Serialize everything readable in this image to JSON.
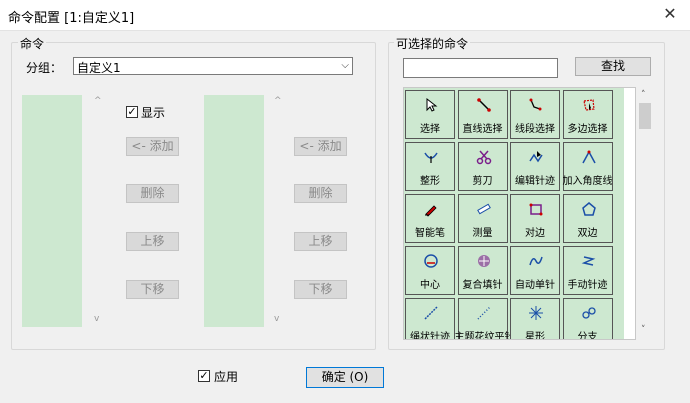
{
  "window": {
    "title": "命令配置 [1:自定义1]",
    "close": "✕"
  },
  "left_group": {
    "legend": "命令",
    "group_label": "分组：",
    "group_value": "自定义1",
    "show_label": "显示",
    "show_checked": "✓",
    "buttons": {
      "add": "<- 添加",
      "delete": "删除",
      "up": "上移",
      "down": "下移"
    }
  },
  "right_group": {
    "legend": "可选择的命令",
    "search_placeholder": "",
    "find_button": "查找",
    "commands": [
      {
        "label": "选择",
        "icon": "cursor-icon"
      },
      {
        "label": "直线选择",
        "icon": "line-select-icon"
      },
      {
        "label": "线段选择",
        "icon": "segment-select-icon"
      },
      {
        "label": "多边选择",
        "icon": "polygon-select-icon"
      },
      {
        "label": "整形",
        "icon": "reshape-icon"
      },
      {
        "label": "剪刀",
        "icon": "scissors-icon"
      },
      {
        "label": "编辑针迹",
        "icon": "edit-stitch-icon"
      },
      {
        "label": "加入角度线",
        "icon": "add-angle-line-icon"
      },
      {
        "label": "智能笔",
        "icon": "smart-pen-icon"
      },
      {
        "label": "测量",
        "icon": "measure-icon"
      },
      {
        "label": "对边",
        "icon": "opposite-edge-icon"
      },
      {
        "label": "双边",
        "icon": "double-edge-icon"
      },
      {
        "label": "中心",
        "icon": "center-icon"
      },
      {
        "label": "复合填针",
        "icon": "compound-fill-icon"
      },
      {
        "label": "自动单针",
        "icon": "auto-single-stitch-icon"
      },
      {
        "label": "手动针迹",
        "icon": "manual-stitch-icon"
      },
      {
        "label": "绳状针迹",
        "icon": "rope-stitch-icon"
      },
      {
        "label": "主题花纹平针",
        "icon": "motif-run-icon"
      },
      {
        "label": "星形",
        "icon": "star-icon"
      },
      {
        "label": "分支",
        "icon": "branch-icon"
      }
    ]
  },
  "footer": {
    "apply_label": "应用",
    "apply_checked": "✓",
    "ok_label": "确定 (O)"
  },
  "colors": {
    "list_bg": "#cde8d0",
    "accent": "#0078d7"
  }
}
